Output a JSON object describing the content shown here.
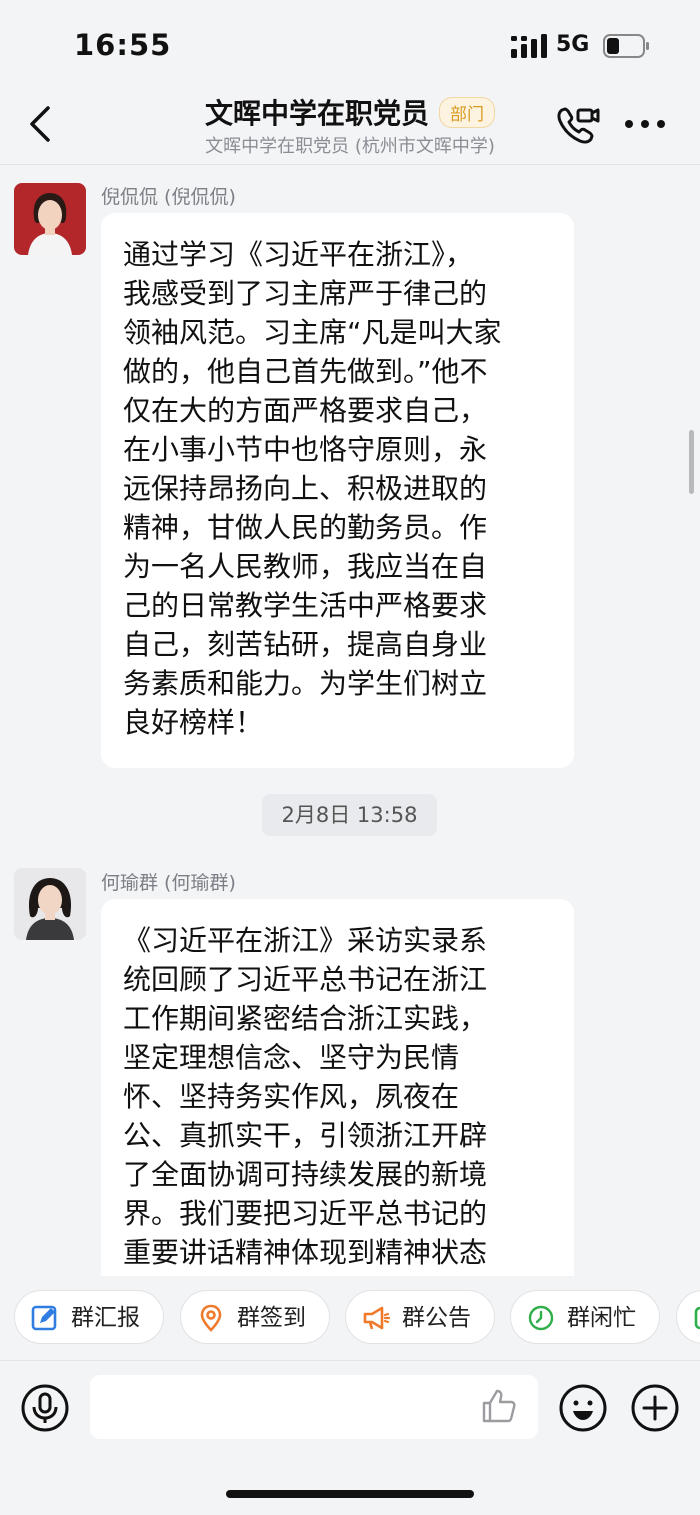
{
  "status_bar": {
    "time": "16:55",
    "network": "5G"
  },
  "header": {
    "title": "文晖中学在职党员",
    "badge": "部门",
    "subtitle": "文晖中学在职党员 (杭州市文晖中学)"
  },
  "messages": [
    {
      "sender": "倪侃侃 (倪侃侃)",
      "lines": [
        "通过学习《习近平在浙江》，",
        "我感受到了习主席严于律己的",
        "领袖风范。习主席“凡是叫大家",
        "做的，他自己首先做到。”他不",
        "仅在大的方面严格要求自己，",
        "在小事小节中也恪守原则，永",
        "远保持昂扬向上、积极进取的",
        "精神，甘做人民的勤务员。作",
        "为一名人民教师，我应当在自",
        "己的日常教学生活中严格要求",
        "自己，刻苦钻研，提高自身业",
        "务素质和能力。为学生们树立",
        "良好榜样！"
      ]
    },
    {
      "sender": "何瑜群 (何瑜群)",
      "lines": [
        "《习近平在浙江》采访实录系",
        "统回顾了习近平总书记在浙江",
        "工作期间紧密结合浙江实践，",
        "坚定理想信念、坚守为民情",
        "怀、坚持务实作风，夙夜在",
        "公、真抓实干，引领浙江开辟",
        "了全面协调可持续发展的新境",
        "界。我们要把习近平总书记的",
        "重要讲话精神体现到精神状态"
      ]
    }
  ],
  "timestamp": "2月8日 13:58",
  "quick_actions": [
    {
      "label": "群汇报",
      "icon": "report-icon",
      "color": "#2f7de1"
    },
    {
      "label": "群签到",
      "icon": "location-pin-icon",
      "color": "#f07a2b"
    },
    {
      "label": "群公告",
      "icon": "megaphone-icon",
      "color": "#f07a2b"
    },
    {
      "label": "群闲忙",
      "icon": "clock-icon",
      "color": "#2fae4a"
    }
  ],
  "colors": {
    "accent_badge": "#d89a1d",
    "background": "#f3f4f6"
  }
}
